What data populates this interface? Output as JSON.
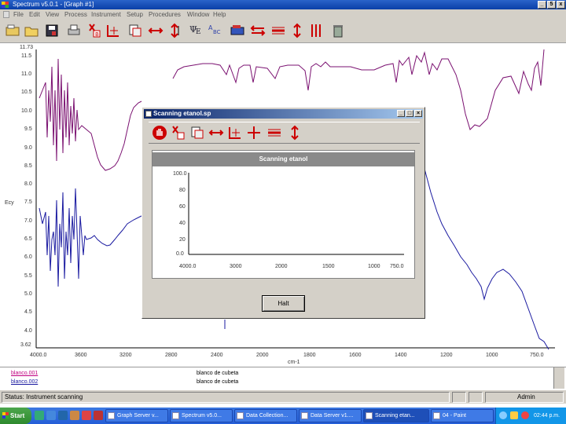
{
  "window": {
    "title": "Spectrum v5.0.1 - [Graph #1]",
    "min": "_",
    "restore": "5",
    "close": "x"
  },
  "menu": [
    "File",
    "Edit",
    "View",
    "Process",
    "Instrument",
    "Setup",
    "Procedures",
    "Window",
    "Help"
  ],
  "toolbar_icons": [
    "open-folder-icon",
    "folder-icon",
    "save-icon",
    "print-icon",
    "cut-icon",
    "scale-icon",
    "copy-icon",
    "shift-icon",
    "arrows-icon",
    "label-icon",
    "abc-icon",
    "read-icon",
    "move-icon",
    "expand-icon",
    "updown-icon",
    "arrows-vertical-icon",
    "trash-icon"
  ],
  "graph": {
    "y_ticks": [
      "11.73",
      "11.5",
      "11.0",
      "10.5",
      "10.0",
      "9.5",
      "9.0",
      "8.5",
      "8.0",
      "7.5",
      "7.0",
      "6.5",
      "6.0",
      "5.5",
      "5.0",
      "4.5",
      "4.0",
      "3.62"
    ],
    "y_label": "Ecy",
    "x_ticks": [
      "4000.0",
      "3600",
      "3200",
      "2800",
      "2400",
      "2000",
      "1800",
      "1600",
      "1400",
      "1200",
      "1000",
      "750.0"
    ],
    "x_label": "cm-1",
    "colors": {
      "purple": "#7a1070",
      "blue": "#1a1aa0"
    }
  },
  "legend": [
    {
      "name": "blanco.001",
      "desc": "blanco de cubeta"
    },
    {
      "name": "blanco.002",
      "desc": "blanco de cubeta"
    }
  ],
  "status": {
    "text": "Status: Instrument scanning",
    "user": "Admin"
  },
  "taskbar": {
    "start": "Start",
    "tasks": [
      "Graph Server v...",
      "Spectrum v5.0...",
      "Data Collection...",
      "Data Server v1....",
      "Scanning etan...",
      "04 - Paint"
    ],
    "clock": "02:44 p.m."
  },
  "dialog": {
    "title": "Scanning etanol.sp",
    "panel_title": "Scanning etanol",
    "y_ticks": [
      "100.0",
      "80",
      "60",
      "40",
      "20",
      "0.0"
    ],
    "x_ticks": [
      "4000.0",
      "3000",
      "2000",
      "1500",
      "1000",
      "750.0"
    ],
    "halt": "Halt"
  }
}
